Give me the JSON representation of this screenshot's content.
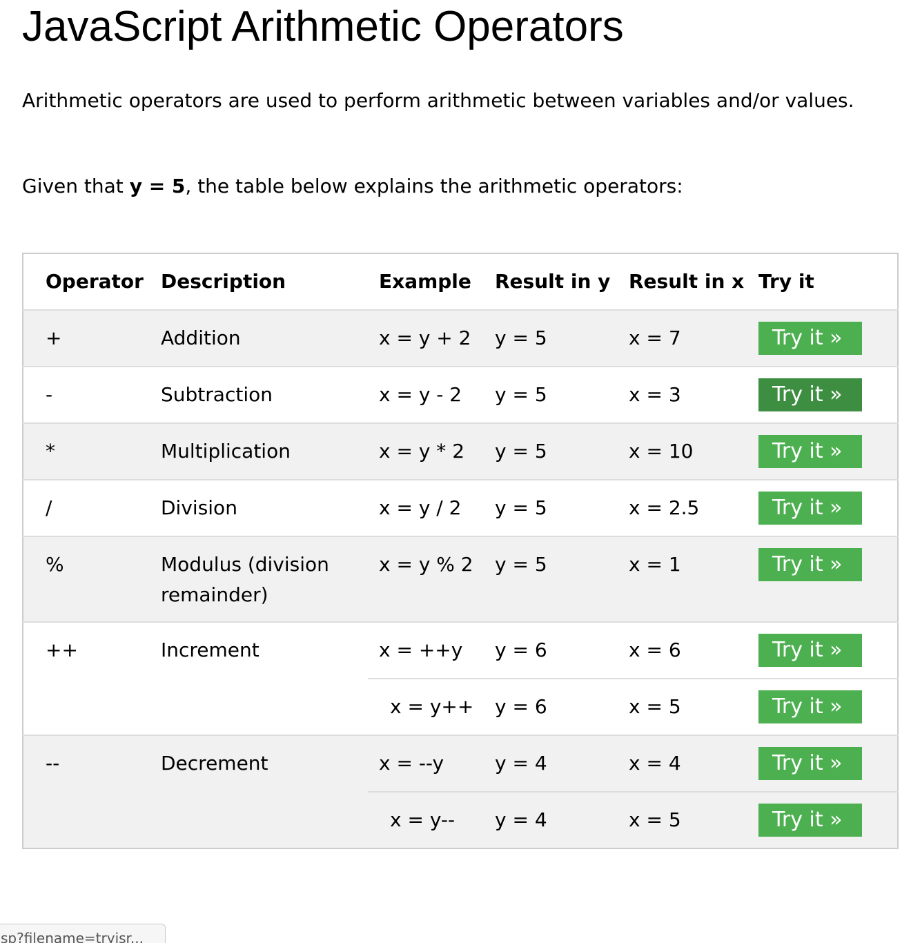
{
  "page": {
    "title": "JavaScript Arithmetic Operators",
    "intro": "Arithmetic operators are used to perform arithmetic between variables and/or values.",
    "given_prefix": "Given that ",
    "given_bold": "y = 5",
    "given_suffix": ", the table below explains the arithmetic operators:"
  },
  "table": {
    "headers": {
      "operator": "Operator",
      "description": "Description",
      "example": "Example",
      "result_y": "Result in y",
      "result_x": "Result in x",
      "try": "Try it"
    },
    "try_label": "Try it »",
    "rows": [
      {
        "operator": "+",
        "description": "Addition",
        "example": "x = y + 2",
        "result_y": "y = 5",
        "result_x": "x = 7"
      },
      {
        "operator": "-",
        "description": "Subtraction",
        "example": "x = y - 2",
        "result_y": "y = 5",
        "result_x": "x = 3"
      },
      {
        "operator": "*",
        "description": "Multiplication",
        "example": "x = y * 2",
        "result_y": "y = 5",
        "result_x": "x = 10"
      },
      {
        "operator": "/",
        "description": "Division",
        "example": "x = y / 2",
        "result_y": "y = 5",
        "result_x": "x = 2.5"
      },
      {
        "operator": "%",
        "description": "Modulus (division remainder)",
        "example": "x = y % 2",
        "result_y": "y = 5",
        "result_x": "x = 1"
      },
      {
        "operator": "++",
        "description": "Increment",
        "example": "x = ++y",
        "result_y": "y = 6",
        "result_x": "x = 6"
      },
      {
        "operator": "",
        "description": "",
        "example": "x = y++",
        "result_y": "y = 6",
        "result_x": "x = 5"
      },
      {
        "operator": "--",
        "description": "Decrement",
        "example": "x = --y",
        "result_y": "y = 4",
        "result_x": "x = 4"
      },
      {
        "operator": "",
        "description": "",
        "example": "x = y--",
        "result_y": "y = 4",
        "result_x": "x = 5"
      }
    ]
  },
  "status_bar": {
    "url": "sp?filename=tryjsr..."
  },
  "colors": {
    "button": "#4caf50",
    "button_hover": "#3e8e41",
    "row_alt": "#f1f1f1",
    "border": "#cccccc"
  }
}
